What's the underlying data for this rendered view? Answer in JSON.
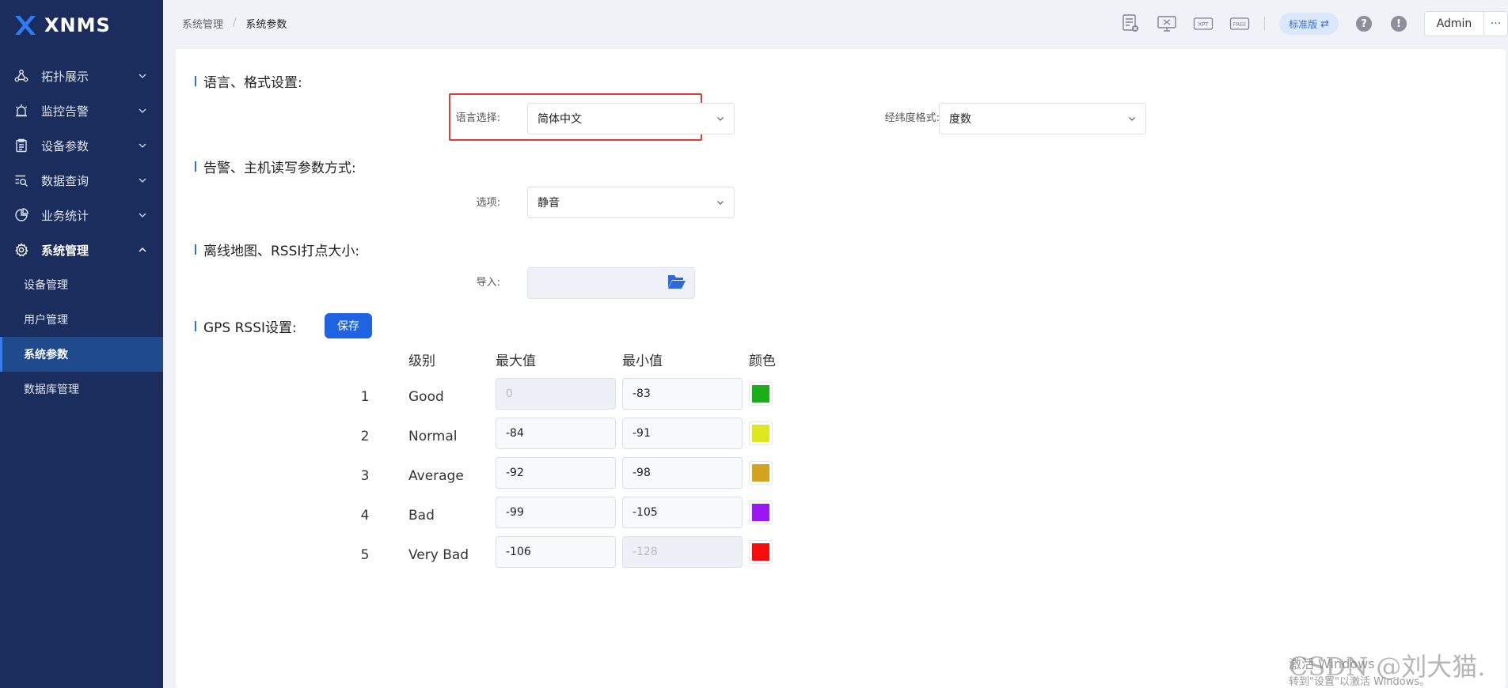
{
  "app": {
    "name": "XNMS"
  },
  "sidebar": {
    "items": [
      {
        "label": "拓扑展示",
        "icon": "topology-icon"
      },
      {
        "label": "监控告警",
        "icon": "alarm-icon"
      },
      {
        "label": "设备参数",
        "icon": "clipboard-icon"
      },
      {
        "label": "数据查询",
        "icon": "search-list-icon"
      },
      {
        "label": "业务统计",
        "icon": "pie-chart-icon"
      },
      {
        "label": "系统管理",
        "icon": "gear-icon"
      }
    ],
    "sub_items": [
      "设备管理",
      "用户管理",
      "系统参数",
      "数据库管理"
    ],
    "active_sub": "系统参数"
  },
  "header": {
    "breadcrumb": [
      "系统管理",
      "系统参数"
    ],
    "breadcrumb_sep": "/",
    "icons": [
      "report-icon",
      "screen-close-icon",
      "xpt-icon",
      "free-icon"
    ],
    "icon_texts": {
      "xpt": "XPT",
      "free": "FREE"
    },
    "edition": "标准版",
    "edition_switch": "⇄",
    "help": "?",
    "alert": "!",
    "user": "Admin",
    "more": "···"
  },
  "sections": {
    "language": {
      "title": "语言、格式设置:",
      "lang_label": "语言选择:",
      "lang_value": "简体中文",
      "coord_label": "经纬度格式:",
      "coord_value": "度数"
    },
    "alarm": {
      "title": "告警、主机读写参数方式:",
      "option_label": "选项:",
      "option_value": "静音"
    },
    "offline": {
      "title": "离线地图、RSSI打点大小:",
      "import_label": "导入:"
    },
    "gps": {
      "title": "GPS RSSI设置:",
      "save": "保存",
      "headers": [
        "级别",
        "最大值",
        "最小值",
        "颜色"
      ],
      "rows": [
        {
          "idx": "1",
          "level": "Good",
          "max": "0",
          "min": "-83",
          "color": "#1aae1a",
          "max_disabled": true,
          "min_disabled": false
        },
        {
          "idx": "2",
          "level": "Normal",
          "max": "-84",
          "min": "-91",
          "color": "#dfe71e",
          "max_disabled": false,
          "min_disabled": false
        },
        {
          "idx": "3",
          "level": "Average",
          "max": "-92",
          "min": "-98",
          "color": "#d4a421",
          "max_disabled": false,
          "min_disabled": false
        },
        {
          "idx": "4",
          "level": "Bad",
          "max": "-99",
          "min": "-105",
          "color": "#9a17f2",
          "max_disabled": false,
          "min_disabled": false
        },
        {
          "idx": "5",
          "level": "Very Bad",
          "max": "-106",
          "min": "-128",
          "color": "#f50d0d",
          "max_disabled": false,
          "min_disabled": true
        }
      ]
    }
  },
  "watermark": {
    "line1": "激活 Windows",
    "line2": "转到\"设置\"以激活 Windows。",
    "csdn": "CSDN @刘大猫."
  }
}
